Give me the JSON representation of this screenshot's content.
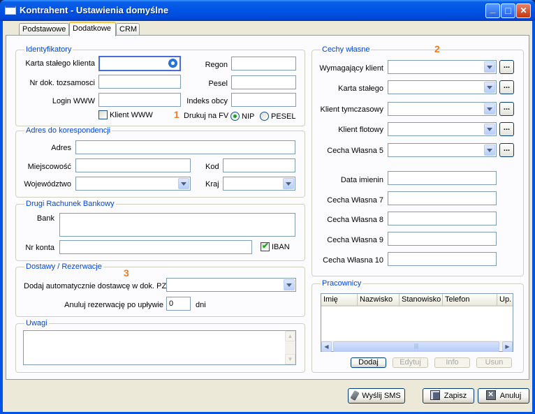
{
  "window": {
    "title": "Kontrahent - Ustawienia domyślne",
    "minimize_glyph": "_",
    "maximize_glyph": "□",
    "close_glyph": "✕"
  },
  "tabs": [
    {
      "label": "Podstawowe"
    },
    {
      "label": "Dodatkowe"
    },
    {
      "label": "CRM"
    }
  ],
  "identyfikatory": {
    "legend": "Identyfikatory",
    "karta_label": "Karta stałego klienta",
    "nr_dok_label": "Nr dok. tozsamosci",
    "login_label": "Login WWW",
    "regon_label": "Regon",
    "pesel_label": "Pesel",
    "indeks_label": "Indeks obcy",
    "klient_www_label": "Klient WWW",
    "drukuj_label": "Drukuj na FV",
    "nip_label": "NIP",
    "pesel_radio_label": "PESEL",
    "karta_value": "",
    "nr_dok_value": "",
    "login_value": "",
    "regon_value": "",
    "pesel_value": "",
    "indeks_value": ""
  },
  "adres": {
    "legend": "Adres do korespondencji",
    "adres_label": "Adres",
    "miejscowosc_label": "Miejscowość",
    "kod_label": "Kod",
    "wojewodztwo_label": "Województwo",
    "kraj_label": "Kraj",
    "adres_value": "",
    "miejscowosc_value": "",
    "kod_value": ""
  },
  "rachunek": {
    "legend": "Drugi Rachunek Bankowy",
    "bank_label": "Bank",
    "nr_konta_label": "Nr konta",
    "iban_label": "IBAN",
    "iban_checked": true,
    "bank_value": "",
    "nr_konta_value": ""
  },
  "dostawy": {
    "legend": "Dostawy / Rezerwacje",
    "dodaj_label": "Dodaj automatycznie dostawcę w dok. PZ",
    "anuluj_label": "Anuluj rezerwację po upływie",
    "anuluj_value": "0",
    "dni_label": "dni"
  },
  "uwagi": {
    "legend": "Uwagi",
    "value": ""
  },
  "cechy": {
    "legend": "Cechy własne",
    "dots_label": "...",
    "combos": [
      {
        "label": "Wymagający klient"
      },
      {
        "label": "Karta stałego"
      },
      {
        "label": "Klient tymczasowy"
      },
      {
        "label": "Klient flotowy"
      },
      {
        "label": "Cecha Własna 5"
      }
    ],
    "fields": [
      {
        "label": "Data imienin",
        "value": ""
      },
      {
        "label": "Cecha Własna 7",
        "value": ""
      },
      {
        "label": "Cecha Własna 8",
        "value": ""
      },
      {
        "label": "Cecha Własna 9",
        "value": ""
      },
      {
        "label": "Cecha Własna 10",
        "value": ""
      }
    ]
  },
  "pracownicy": {
    "legend": "Pracownicy",
    "columns": [
      "Imię",
      "Nazwisko",
      "Stanowisko",
      "Telefon",
      "Up."
    ],
    "scroll_left": "◀",
    "scroll_right": "▶",
    "thumb_grip": "|||",
    "buttons": {
      "dodaj": "Dodaj",
      "edytuj": "Edytuj",
      "info": "Info",
      "usun": "Usun"
    }
  },
  "markers": [
    "1",
    "2",
    "3"
  ],
  "footer": {
    "sms_label": "Wyślij SMS",
    "zapisz_label": "Zapisz",
    "anuluj_label": "Anuluj"
  },
  "colors": {
    "titlebar": "#0054e3",
    "legend_text": "#0046d5",
    "marker": "#f07a1f",
    "check_mark": "#21a121"
  }
}
